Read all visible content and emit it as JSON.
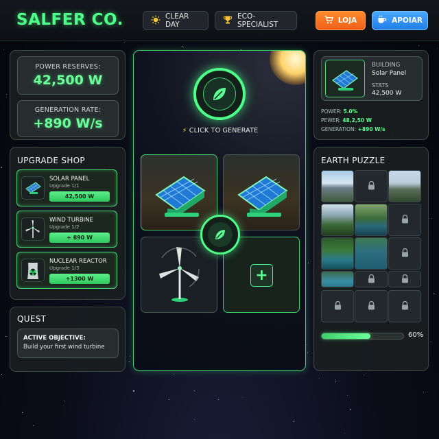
{
  "header": {
    "logo": "SALFER CO.",
    "weather_label": "CLEAR DAY",
    "rank_label": "ECO-SPECIALIST",
    "shop_label": "LOJA",
    "support_label": "APOIAR"
  },
  "stats": {
    "power_label": "POWER RESERVES:",
    "power_value": "42,500 W",
    "rate_label": "GENERATION RATE:",
    "rate_value": "+890 W/s"
  },
  "shop": {
    "title": "UPGRADE SHOP",
    "items": [
      {
        "name": "SOLAR PANEL",
        "sub": "Upgrade 1/1",
        "price": "42,500 W",
        "icon": "solar-panel-icon"
      },
      {
        "name": "WIND TURBINE",
        "sub": "Upgrade 1/2",
        "price": "+ 890 W",
        "icon": "wind-turbine-icon"
      },
      {
        "name": "NUCLEAR REACTOR",
        "sub": "Upgrade 1/3",
        "price": "+1300 W",
        "icon": "nuclear-reactor-icon"
      }
    ]
  },
  "quest": {
    "title": "QUEST",
    "objective_label": "ACTIVE OBJECTIVE:",
    "objective_text": "Build your first wind turbine"
  },
  "generator": {
    "cta": "CLICK TO GENERATE",
    "tiles": [
      "solar-panel",
      "solar-panel",
      "wind-turbine",
      "add-slot"
    ]
  },
  "building": {
    "label": "BUILDING",
    "name": "Solar Panel",
    "stats_label": "STATS",
    "stats_value": "42,500 W",
    "power_label": "POWER:",
    "power_value": "5.0%",
    "pewer_label": "PEWER:",
    "pewer_value": "48,2,50 W",
    "generation_label": "GENERATION:",
    "generation_value": "+890 W/s"
  },
  "puzzle": {
    "title": "EARTH PUZZLE",
    "progress": 0.6,
    "progress_label": "60%"
  },
  "colors": {
    "accent": "#4dff88",
    "shop_button": "#f0601a",
    "support_button": "#1f7fe6"
  }
}
